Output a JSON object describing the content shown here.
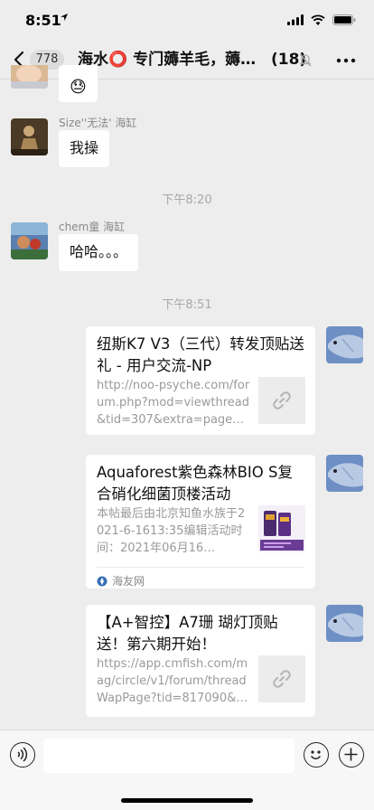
{
  "status_bar": {
    "time": "8:51"
  },
  "nav": {
    "unread_count": "778",
    "title": "海水⭕ 专门薅羊毛，薅羊毛，薅羊毛",
    "member_count": "(18)"
  },
  "messages": [
    {
      "sender": "",
      "text": "😓"
    },
    {
      "sender": "Size''无法' 海缸",
      "text": "我操"
    },
    {
      "sender": "chem童 海缸",
      "text": "哈哈。。。"
    }
  ],
  "timestamps": [
    "下午8:20",
    "下午8:51"
  ],
  "link_cards": [
    {
      "title": "纽斯K7 V3（三代）转发顶贴送礼 - 用户交流-NP",
      "description": "http://noo-psyche.com/forum.php?mod=viewthread&tid=307&extra=page…",
      "thumb_icon": "link-icon"
    },
    {
      "title": "Aquaforest紫色森林BIO S复合硝化细菌顶楼活动",
      "description": "本帖最后由北京知鱼水族于2021-6-1613:35编辑活动时间：2021年06月16…",
      "thumb_icon": "product-image",
      "source": "海友网"
    },
    {
      "title": "【A+智控】A7珊 瑚灯顶贴送！第六期开始！",
      "description": "https://app.cmfish.com/mag/circle/v1/forum/threadWapPage?tid=817090&…",
      "thumb_icon": "link-icon"
    }
  ],
  "input_bar": {
    "placeholder": ""
  }
}
